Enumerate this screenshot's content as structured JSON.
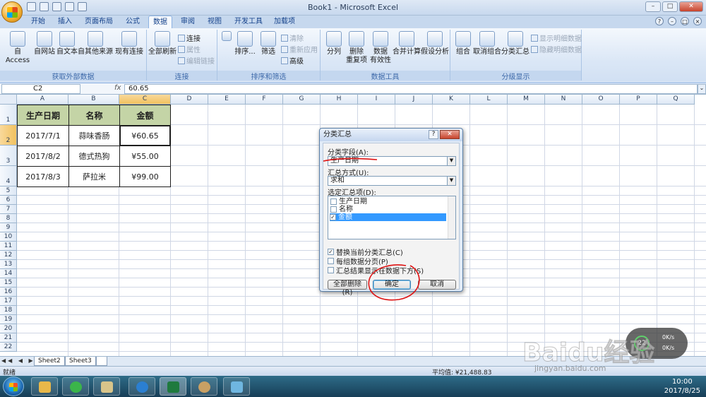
{
  "window": {
    "title": "Book1 - Microsoft Excel"
  },
  "ribbon": {
    "tabs": [
      "开始",
      "插入",
      "页面布局",
      "公式",
      "数据",
      "审阅",
      "视图",
      "开发工具",
      "加载项"
    ],
    "active_tab": "数据",
    "groups": {
      "external": {
        "label": "获取外部数据",
        "buttons": [
          "自 Access",
          "自网站",
          "自文本",
          "自其他来源",
          "现有连接"
        ]
      },
      "connections": {
        "label": "连接",
        "refresh": "全部刷新",
        "items": [
          "连接",
          "属性",
          "编辑链接"
        ]
      },
      "sortfilter": {
        "label": "排序和筛选",
        "sort": "排序...",
        "filter": "筛选",
        "items": [
          "清除",
          "重新应用",
          "高级"
        ]
      },
      "datatools": {
        "label": "数据工具",
        "buttons": [
          "分列",
          "删除\n重复项",
          "数据\n有效性",
          "合并计算",
          "假设分析"
        ]
      },
      "outline": {
        "label": "分级显示",
        "buttons": [
          "组合",
          "取消组合",
          "分类汇总"
        ],
        "items": [
          "显示明细数据",
          "隐藏明细数据"
        ]
      }
    }
  },
  "formula_bar": {
    "name_box": "C2",
    "fx": "fx",
    "content": "60.65"
  },
  "columns": [
    "A",
    "B",
    "C",
    "D",
    "E",
    "F",
    "G",
    "H",
    "I",
    "J",
    "K",
    "L",
    "M",
    "N",
    "O",
    "P",
    "Q"
  ],
  "rows": [
    "1",
    "2",
    "3",
    "4",
    "5",
    "6",
    "7",
    "8",
    "9",
    "10",
    "11",
    "12",
    "13",
    "14",
    "15",
    "16",
    "17",
    "18",
    "19",
    "20",
    "21",
    "22"
  ],
  "table": {
    "headers": [
      "生产日期",
      "名称",
      "金额"
    ],
    "rows": [
      [
        "2017/7/1",
        "蒜味香肠",
        "¥60.65"
      ],
      [
        "2017/8/2",
        "德式热狗",
        "¥55.00"
      ],
      [
        "2017/8/3",
        "萨拉米",
        "¥99.00"
      ]
    ]
  },
  "sheets": [
    "Sheet2",
    "Sheet3"
  ],
  "status": {
    "ready": "就绪",
    "average": "平均值: ¥21,488.83"
  },
  "dialog": {
    "title": "分类汇总",
    "field_label": "分类字段(A):",
    "field_value": "生产日期",
    "func_label": "汇总方式(U):",
    "func_value": "求和",
    "items_label": "选定汇总项(D):",
    "items": [
      {
        "label": "生产日期",
        "checked": false
      },
      {
        "label": "名称",
        "checked": false
      },
      {
        "label": "金额",
        "checked": true
      }
    ],
    "options": [
      {
        "label": "替换当前分类汇总(C)",
        "checked": true
      },
      {
        "label": "每组数据分页(P)",
        "checked": false
      },
      {
        "label": "汇总结果显示在数据下方(S)",
        "checked": false
      }
    ],
    "btn_remove_all": "全部删除(R)",
    "btn_ok": "确定",
    "btn_cancel": "取消"
  },
  "taskbar": {
    "time": "10:00",
    "date": "2017/8/25"
  },
  "net_widget": {
    "percent": "22",
    "up": "0K/s",
    "down": "0K/s"
  },
  "watermark": {
    "text": "Baidu经验",
    "url": "jingyan.baidu.com"
  }
}
